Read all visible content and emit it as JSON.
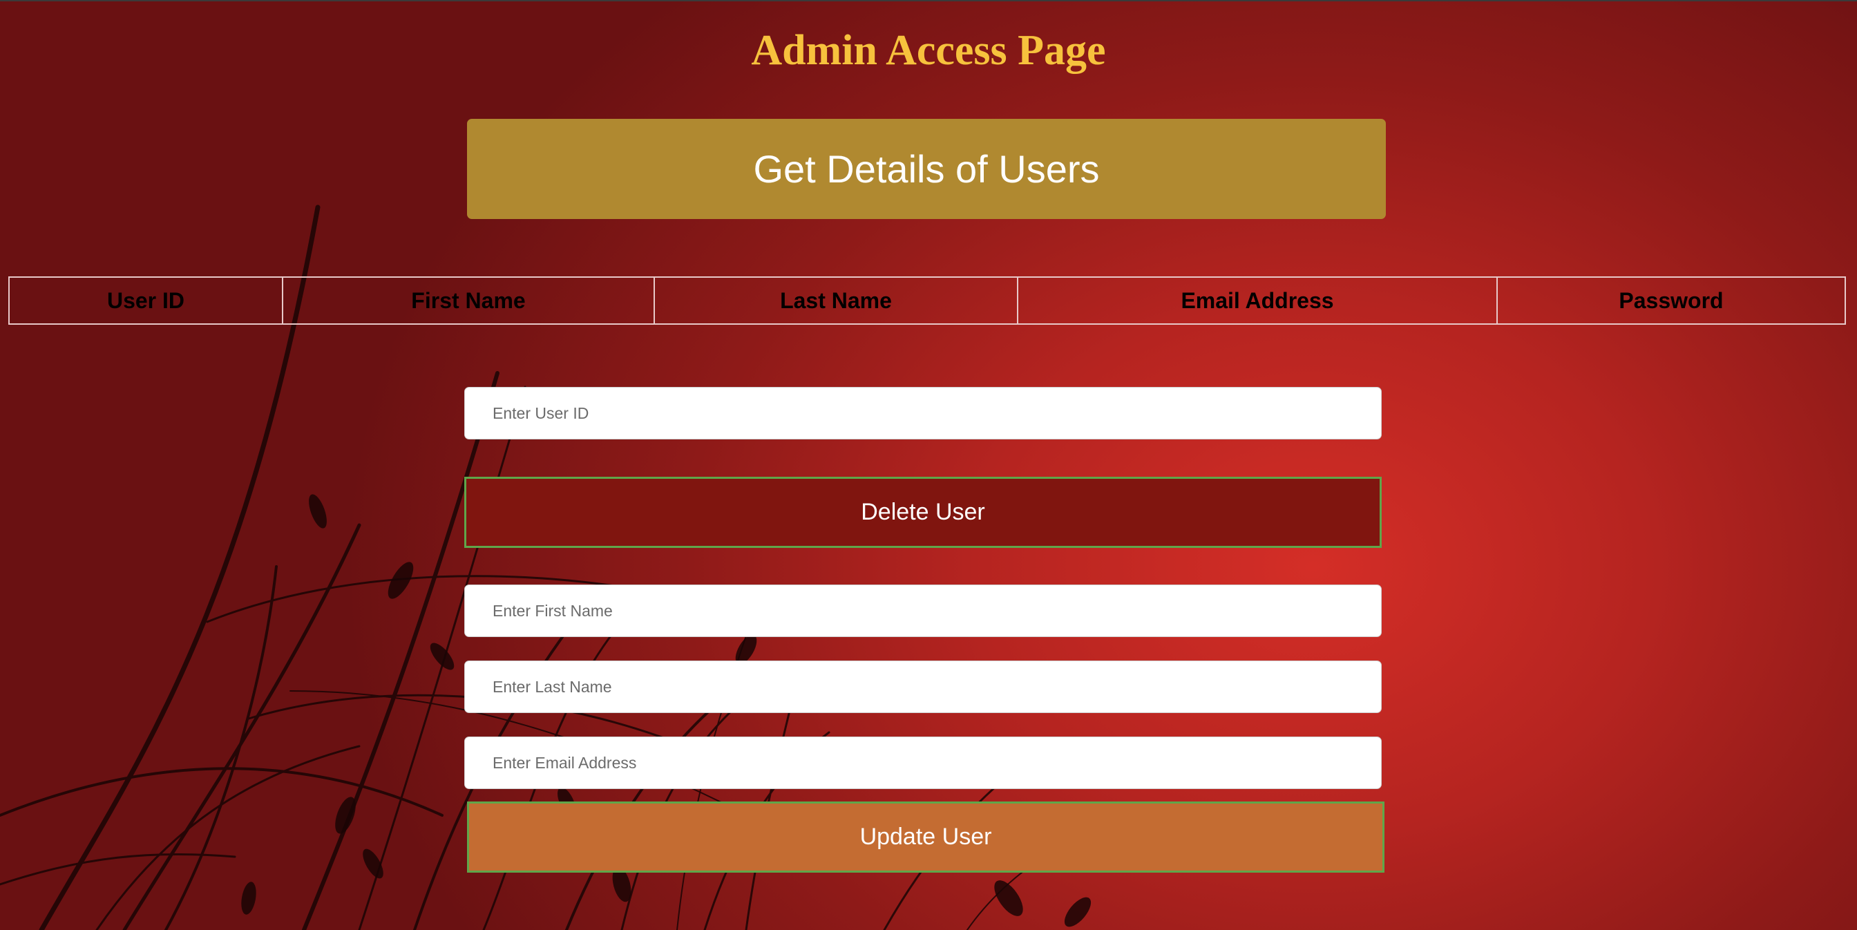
{
  "page": {
    "title": "Admin Access Page"
  },
  "actions": {
    "get_details_label": "Get Details of Users",
    "delete_label": "Delete User",
    "update_label": "Update User"
  },
  "users_table": {
    "columns": [
      "User ID",
      "First Name",
      "Last Name",
      "Email Address",
      "Password"
    ],
    "rows": []
  },
  "form": {
    "user_id": {
      "placeholder": "Enter User ID",
      "value": ""
    },
    "first_name": {
      "placeholder": "Enter First Name",
      "value": ""
    },
    "last_name": {
      "placeholder": "Enter Last Name",
      "value": ""
    },
    "email": {
      "placeholder": "Enter Email Address",
      "value": ""
    }
  },
  "colors": {
    "title": "#f7c23d",
    "get_button": "#b08930",
    "delete_button": "#80150f",
    "update_button": "#c46c32",
    "button_border": "#5fa64a",
    "background": "#b52420"
  }
}
